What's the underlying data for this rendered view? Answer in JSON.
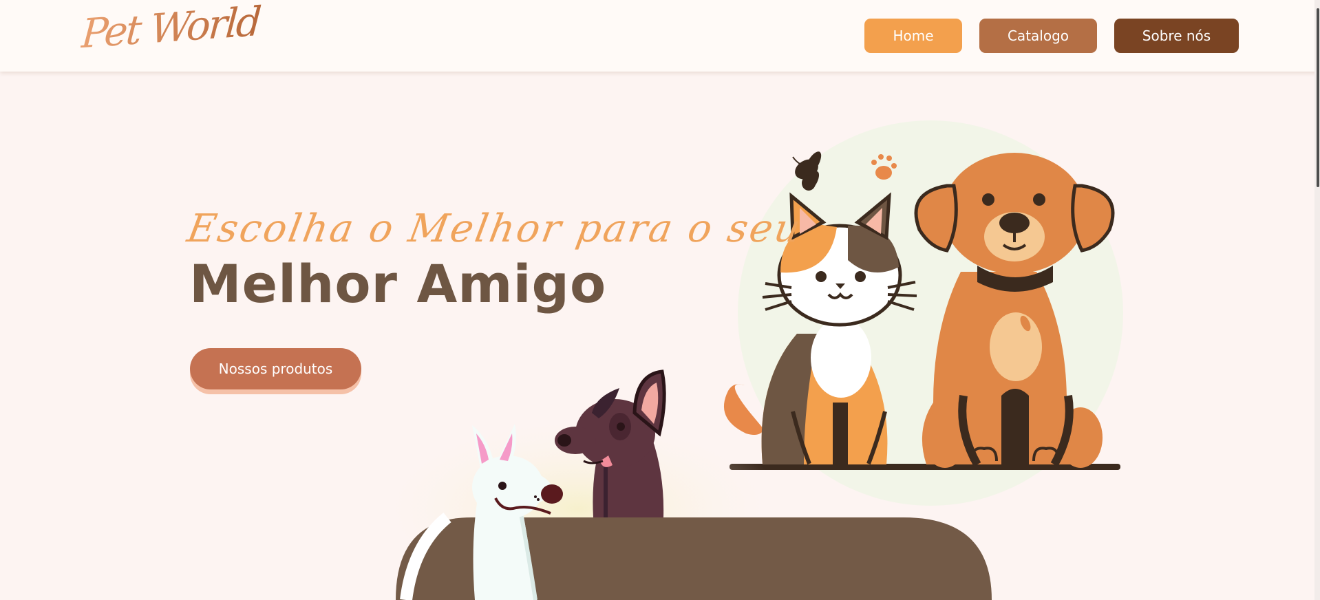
{
  "header": {
    "logo_text": "Pet World",
    "nav": {
      "home_label": "Home",
      "catalog_label": "Catalogo",
      "about_label": "Sobre nós"
    }
  },
  "hero": {
    "tagline": "Escolha o Melhor para o seu",
    "title": "Melhor Amigo",
    "cta_label": "Nossos produtos"
  },
  "colors": {
    "background": "#fdf4f2",
    "header_background": "#fffaf7",
    "home_button": "#f3a04d",
    "catalog_button": "#b46f45",
    "about_button": "#7a4423",
    "cta_button": "#c57252",
    "tagline": "#f0a45c",
    "title": "#6e5643"
  }
}
